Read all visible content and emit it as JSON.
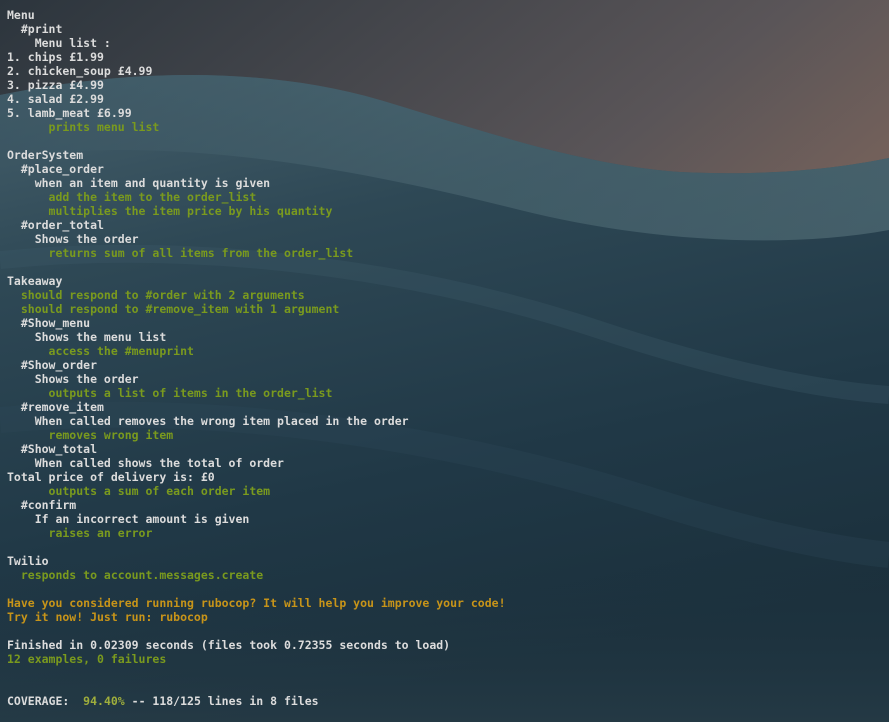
{
  "colors": {
    "default_text": "#dcdcdc",
    "pass_green": "#7a9a1e",
    "warning_orange": "#c79419",
    "coverage_green": "#9fae3c"
  },
  "lines": [
    {
      "text": "Menu",
      "style": "white"
    },
    {
      "text": "  #print",
      "style": "white"
    },
    {
      "text": "    Menu list :",
      "style": "white"
    },
    {
      "text": "1. chips £1.99",
      "style": "white"
    },
    {
      "text": "2. chicken_soup £4.99",
      "style": "white"
    },
    {
      "text": "3. pizza £4.99",
      "style": "white"
    },
    {
      "text": "4. salad £2.99",
      "style": "white"
    },
    {
      "text": "5. lamb_meat £6.99",
      "style": "white"
    },
    {
      "text": "      prints menu list",
      "style": "green"
    },
    {
      "text": "",
      "style": "blank"
    },
    {
      "text": "OrderSystem",
      "style": "white"
    },
    {
      "text": "  #place_order",
      "style": "white"
    },
    {
      "text": "    when an item and quantity is given",
      "style": "white"
    },
    {
      "text": "      add the item to the order_list",
      "style": "green"
    },
    {
      "text": "      multiplies the item price by his quantity",
      "style": "green"
    },
    {
      "text": "  #order_total",
      "style": "white"
    },
    {
      "text": "    Shows the order",
      "style": "white"
    },
    {
      "text": "      returns sum of all items from the order_list",
      "style": "green"
    },
    {
      "text": "",
      "style": "blank"
    },
    {
      "text": "Takeaway",
      "style": "white"
    },
    {
      "text": "  should respond to #order with 2 arguments",
      "style": "green"
    },
    {
      "text": "  should respond to #remove_item with 1 argument",
      "style": "green"
    },
    {
      "text": "  #Show_menu",
      "style": "white"
    },
    {
      "text": "    Shows the menu list",
      "style": "white"
    },
    {
      "text": "      access the #menuprint",
      "style": "green"
    },
    {
      "text": "  #Show_order",
      "style": "white"
    },
    {
      "text": "    Shows the order",
      "style": "white"
    },
    {
      "text": "      outputs a list of items in the order_list",
      "style": "green"
    },
    {
      "text": "  #remove_item",
      "style": "white"
    },
    {
      "text": "    When called removes the wrong item placed in the order",
      "style": "white"
    },
    {
      "text": "      removes wrong item",
      "style": "green"
    },
    {
      "text": "  #Show_total",
      "style": "white"
    },
    {
      "text": "    When called shows the total of order",
      "style": "white"
    },
    {
      "text": "Total price of delivery is: £0",
      "style": "white"
    },
    {
      "text": "      outputs a sum of each order item",
      "style": "green"
    },
    {
      "text": "  #confirm",
      "style": "white"
    },
    {
      "text": "    If an incorrect amount is given",
      "style": "white"
    },
    {
      "text": "      raises an error",
      "style": "green"
    },
    {
      "text": "",
      "style": "blank"
    },
    {
      "text": "Twilio",
      "style": "white"
    },
    {
      "text": "  responds to account.messages.create",
      "style": "green"
    },
    {
      "text": "",
      "style": "blank"
    },
    {
      "text": "Have you considered running rubocop? It will help you improve your code!",
      "style": "orange"
    },
    {
      "text": "Try it now! Just run: rubocop",
      "style": "orange"
    },
    {
      "text": "",
      "style": "blank"
    },
    {
      "text": "Finished in 0.02309 seconds (files took 0.72355 seconds to load)",
      "style": "white"
    },
    {
      "text": "12 examples, 0 failures",
      "style": "green"
    },
    {
      "text": "",
      "style": "blank"
    },
    {
      "text": "",
      "style": "blank"
    }
  ],
  "coverage": {
    "label": "COVERAGE:  ",
    "percent": "94.40%",
    "detail": " -- 118/125 lines in 8 files"
  }
}
